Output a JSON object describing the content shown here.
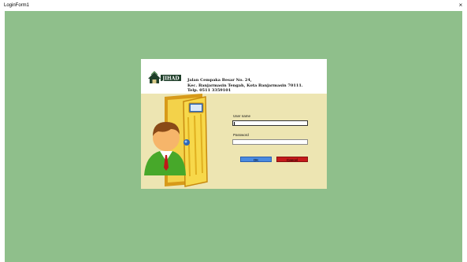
{
  "window": {
    "title": "LoginForm1",
    "close_glyph": "×"
  },
  "colors": {
    "desktop_bg": "#8fbf8b",
    "panel_bg": "#ede5b2",
    "header_bg": "#ffffff",
    "ok_button": "#4a8ae0",
    "cancel_button": "#c41a1a"
  },
  "header": {
    "logo_text": "JIHAD",
    "address_lines": [
      "Jalan Cempaka Besar No. 24,",
      "Kec. Banjarmasin Tengah, Kota Banjarmasin 70111.",
      "Telp. 0511 3359101"
    ]
  },
  "illustration": {
    "icon": "user-at-door-icon"
  },
  "form": {
    "username_label": "User name",
    "username_value": "",
    "password_label": "Password",
    "password_value": "",
    "ok_label": "OK",
    "cancel_label": "Cancel"
  }
}
